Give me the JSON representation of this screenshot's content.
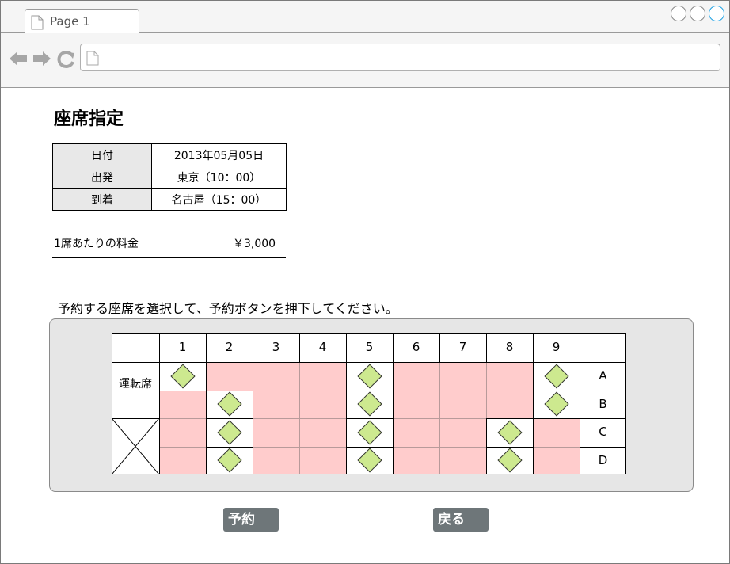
{
  "browser": {
    "tab_title": "Page 1",
    "address": "",
    "icons": [
      "page-icon",
      "back-arrow-icon",
      "forward-arrow-icon",
      "reload-icon"
    ]
  },
  "page": {
    "title": "座席指定",
    "info": [
      {
        "label": "日付",
        "value": "2013年05月05日"
      },
      {
        "label": "出発",
        "value": "東京（10：00）"
      },
      {
        "label": "到着",
        "value": "名古屋（15：00）"
      }
    ],
    "price_label": "1席あたりの料金",
    "price_value": "￥3,000",
    "instruction": "予約する座席を選択して、予約ボタンを押下してください。",
    "seat_map": {
      "columns": [
        "1",
        "2",
        "3",
        "4",
        "5",
        "6",
        "7",
        "8",
        "9"
      ],
      "rows": [
        "A",
        "B",
        "C",
        "D"
      ],
      "driver_label": "運転席",
      "seats": [
        [
          "available",
          "taken",
          "taken",
          "taken",
          "available",
          "taken",
          "taken",
          "taken",
          "available"
        ],
        [
          "taken",
          "available",
          "taken",
          "taken",
          "available",
          "taken",
          "taken",
          "taken",
          "available"
        ],
        [
          "taken",
          "available",
          "taken",
          "taken",
          "available",
          "taken",
          "taken",
          "available",
          "taken"
        ],
        [
          "taken",
          "available",
          "taken",
          "taken",
          "available",
          "taken",
          "taken",
          "available",
          "taken"
        ]
      ],
      "colors": {
        "taken": "#ffcccc",
        "available_marker": "#cde98f",
        "panel": "#e6e6e6"
      }
    },
    "buttons": {
      "reserve": "予約",
      "back": "戻る"
    },
    "button_color": "#6e7679"
  }
}
